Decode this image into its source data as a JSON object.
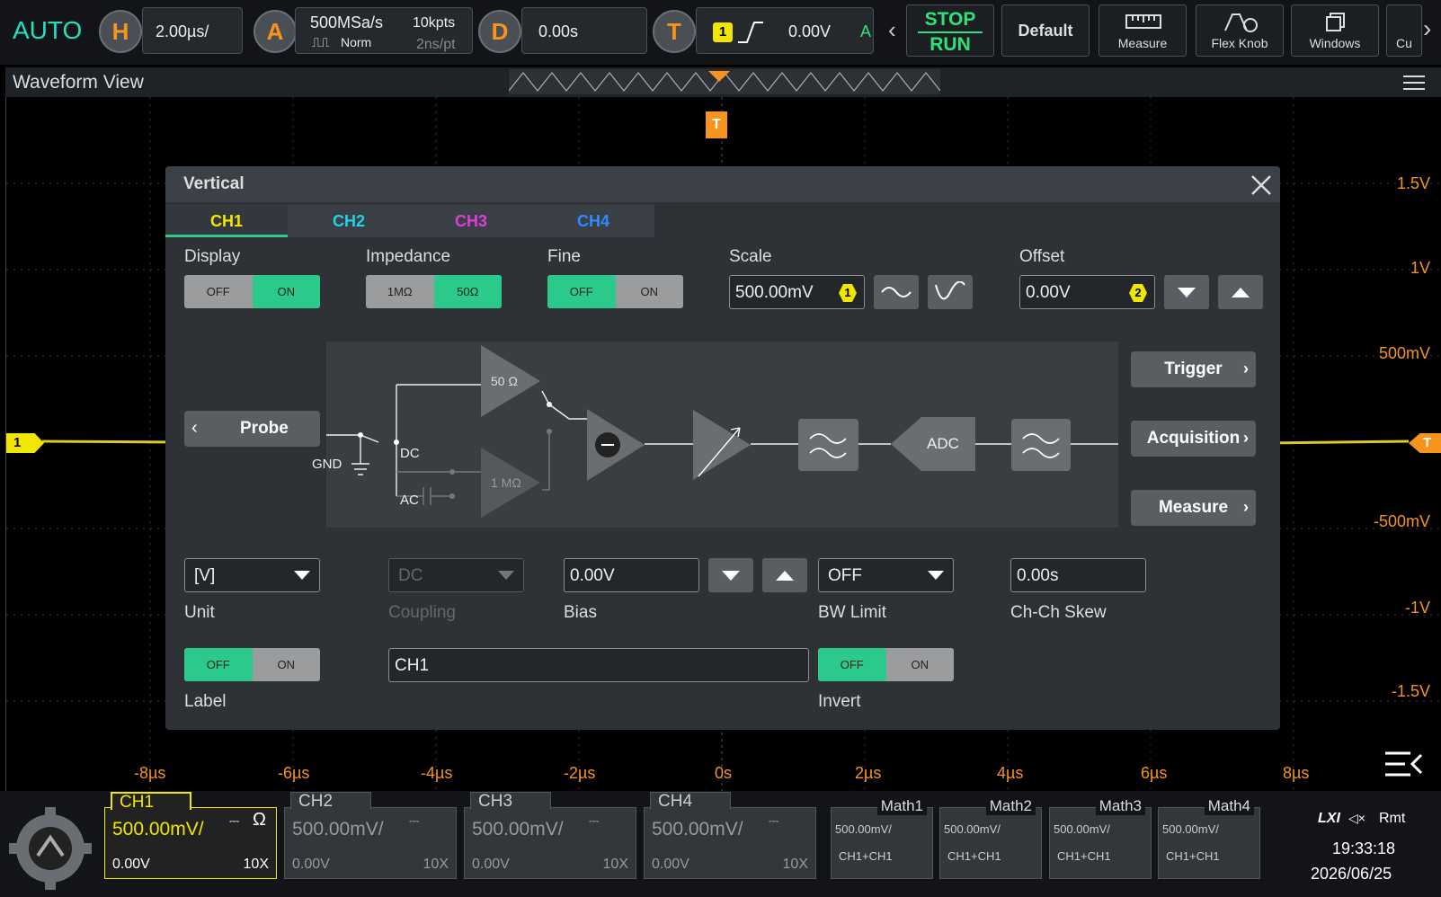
{
  "topbar": {
    "mode": "AUTO",
    "h": {
      "letter": "H",
      "value": "2.00µs/"
    },
    "a": {
      "letter": "A",
      "rate": "500MSa/s",
      "points": "10kpts",
      "acq": "Norm",
      "res": "2ns/pt"
    },
    "d": {
      "letter": "D",
      "value": "0.00s"
    },
    "t": {
      "letter": "T",
      "channel": "1",
      "level": "0.00V",
      "mode": "A"
    },
    "stop": "STOP",
    "run": "RUN",
    "default": "Default",
    "measure": "Measure",
    "flexknob": "Flex Knob",
    "windows": "Windows",
    "cut": "Cu"
  },
  "waveform": {
    "title": "Waveform View",
    "trigger_marker": "T",
    "ch1_marker": "1",
    "y_labels": [
      "1.5V",
      "1V",
      "500mV",
      "-500mV",
      "-1V",
      "-1.5V"
    ],
    "x_labels": [
      "-8µs",
      "-6µs",
      "-4µs",
      "-2µs",
      "0s",
      "2µs",
      "4µs",
      "6µs",
      "8µs"
    ]
  },
  "dialog": {
    "title": "Vertical",
    "tabs": [
      {
        "label": "CH1",
        "color": "#f1e600"
      },
      {
        "label": "CH2",
        "color": "#22d0e8"
      },
      {
        "label": "CH3",
        "color": "#e03cdc"
      },
      {
        "label": "CH4",
        "color": "#2f8cff"
      }
    ],
    "display": {
      "label": "Display",
      "off": "OFF",
      "on": "ON"
    },
    "impedance": {
      "label": "Impedance",
      "a": "1MΩ",
      "b": "50Ω"
    },
    "fine": {
      "label": "Fine",
      "off": "OFF",
      "on": "ON"
    },
    "scale": {
      "label": "Scale",
      "value": "500.00mV",
      "knob": "1"
    },
    "offset": {
      "label": "Offset",
      "value": "0.00V",
      "knob": "2"
    },
    "diagram": {
      "probe": "Probe",
      "gnd": "GND",
      "dc": "DC",
      "ac": "AC",
      "r50": "50 Ω",
      "r1m": "1 MΩ",
      "adc": "ADC"
    },
    "side": {
      "trigger": "Trigger",
      "acquisition": "Acquisition",
      "measure": "Measure"
    },
    "unit": {
      "label": "Unit",
      "value": "[V]"
    },
    "coupling": {
      "label": "Coupling",
      "value": "DC"
    },
    "bias": {
      "label": "Bias",
      "value": "0.00V"
    },
    "bwlimit": {
      "label": "BW Limit",
      "value": "OFF"
    },
    "skew": {
      "label": "Ch-Ch Skew",
      "value": "0.00s"
    },
    "label_toggle": {
      "label": "Label",
      "off": "OFF",
      "on": "ON"
    },
    "label_text": "CH1",
    "invert": {
      "label": "Invert",
      "off": "OFF",
      "on": "ON"
    }
  },
  "bottom": {
    "channels": [
      {
        "name": "CH1",
        "scale": "500.00mV/",
        "offset": "0.00V",
        "probe": "10X",
        "imp": "Ω"
      },
      {
        "name": "CH2",
        "scale": "500.00mV/",
        "offset": "0.00V",
        "probe": "10X"
      },
      {
        "name": "CH3",
        "scale": "500.00mV/",
        "offset": "0.00V",
        "probe": "10X"
      },
      {
        "name": "CH4",
        "scale": "500.00mV/",
        "offset": "0.00V",
        "probe": "10X"
      }
    ],
    "math": [
      {
        "name": "Math1",
        "scale": "500.00mV/",
        "expr": "CH1+CH1"
      },
      {
        "name": "Math2",
        "scale": "500.00mV/",
        "expr": "CH1+CH1"
      },
      {
        "name": "Math3",
        "scale": "500.00mV/",
        "expr": "CH1+CH1"
      },
      {
        "name": "Math4",
        "scale": "500.00mV/",
        "expr": "CH1+CH1"
      }
    ],
    "status": {
      "lxi": "LXI",
      "rmt": "Rmt",
      "time": "19:33:18",
      "date": "2026/06/25"
    }
  }
}
